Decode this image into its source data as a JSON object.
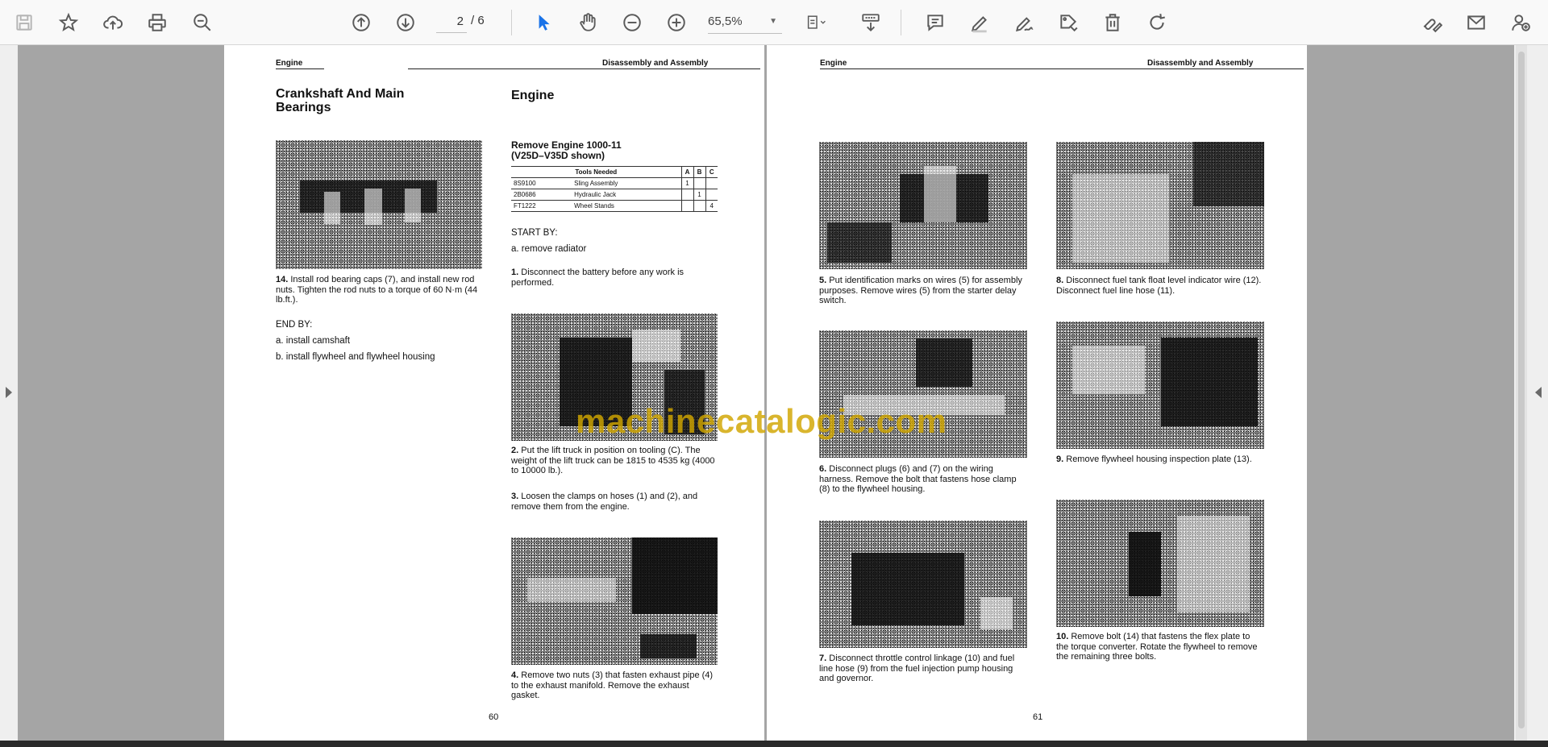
{
  "toolbar": {
    "save_icon": "save-icon",
    "bookmark_icon": "star-icon",
    "upload_icon": "cloud-upload-icon",
    "print_icon": "printer-icon",
    "find_icon": "zoom-out-search-icon",
    "prev_page_icon": "arrow-up-circle-icon",
    "next_page_icon": "arrow-down-circle-icon",
    "current_page": "2",
    "page_total": "/ 6",
    "select_icon": "cursor-icon",
    "hand_icon": "hand-icon",
    "zoom_out_icon": "minus-circle-icon",
    "zoom_in_icon": "plus-circle-icon",
    "zoom_level": "65,5%",
    "accent_color": "#1a73e8"
  },
  "page_left": {
    "header_left": "Engine",
    "header_right": "Disassembly and Assembly",
    "col1_title_line1": "Crankshaft And Main",
    "col1_title_line2": "Bearings",
    "step14_num": "14.",
    "step14_text": "Install rod bearing caps (7), and install new rod nuts. Tighten the rod nuts to a torque of 60 N·m (44 lb.ft.).",
    "end_by": "END BY:",
    "end_a": "a. install camshaft",
    "end_b": "b. install flywheel and flywheel housing",
    "col2_title": "Engine",
    "remove_title": "Remove Engine     1000-11",
    "remove_subtitle": "(V25D–V35D shown)",
    "tools_header": "Tools Needed",
    "tools_cols": [
      "A",
      "B",
      "C"
    ],
    "tools": [
      {
        "part": "8S9100",
        "name": "Sling Assembly",
        "a": "1",
        "b": "",
        "c": ""
      },
      {
        "part": "2B0686",
        "name": "Hydraulic Jack",
        "a": "",
        "b": "1",
        "c": ""
      },
      {
        "part": "FT1222",
        "name": "Wheel Stands",
        "a": "",
        "b": "",
        "c": "4"
      }
    ],
    "start_by": "START BY:",
    "start_a": "a. remove radiator",
    "step1_num": "1.",
    "step1_text": "Disconnect the battery before any work is performed.",
    "step2_num": "2.",
    "step2_text": "Put the lift truck in position on tooling (C). The weight of the lift truck can be 1815 to 4535 kg (4000 to 10000 lb.).",
    "step3_num": "3.",
    "step3_text": "Loosen the clamps on hoses (1) and (2), and remove them from the engine.",
    "step4_num": "4.",
    "step4_text": "Remove two nuts (3) that fasten exhaust pipe (4) to the exhaust manifold. Remove the exhaust gasket.",
    "page_number": "60"
  },
  "page_right": {
    "header_left": "Engine",
    "header_right": "Disassembly and Assembly",
    "step5_num": "5.",
    "step5_text": "Put identification marks on wires (5) for assembly purposes. Remove wires (5) from the starter delay switch.",
    "step6_num": "6.",
    "step6_text": "Disconnect plugs (6) and (7) on the wiring harness. Remove the bolt that fastens hose clamp (8) to the flywheel housing.",
    "step7_num": "7.",
    "step7_text": "Disconnect throttle control linkage (10) and fuel line hose (9) from the fuel injection pump housing and governor.",
    "step8_num": "8.",
    "step8_text": "Disconnect fuel tank float level indicator wire (12). Disconnect fuel line hose (11).",
    "step9_num": "9.",
    "step9_text": "Remove flywheel housing inspection plate (13).",
    "step10_num": "10.",
    "step10_text": "Remove bolt (14) that fastens the flex plate to the torque converter. Rotate the flywheel to remove the remaining three bolts.",
    "page_number": "61"
  },
  "watermark": "machinecatalogic.com",
  "watermark_color": "#d1a600"
}
